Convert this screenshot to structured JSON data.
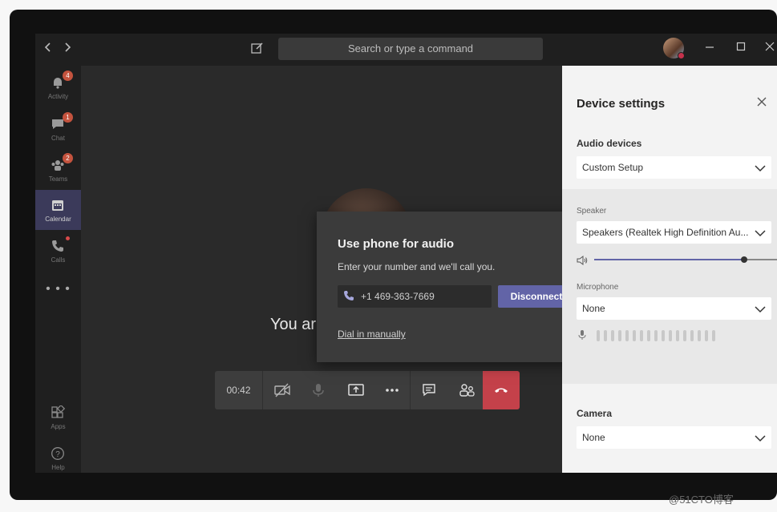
{
  "titlebar": {
    "back_icon": "chevron-left-icon",
    "forward_icon": "chevron-right-icon",
    "compose_icon": "compose-icon",
    "search_placeholder": "Search or type a command",
    "window_controls": [
      "minimize-icon",
      "maximize-icon",
      "close-icon"
    ]
  },
  "rail": {
    "items": [
      {
        "label": "Activity",
        "icon": "bell-icon",
        "badge": "4"
      },
      {
        "label": "Chat",
        "icon": "chat-icon",
        "badge": "1"
      },
      {
        "label": "Teams",
        "icon": "teams-icon",
        "badge": "2"
      },
      {
        "label": "Calendar",
        "icon": "calendar-icon",
        "badge": ""
      },
      {
        "label": "Calls",
        "icon": "phone-icon",
        "badge": ""
      }
    ],
    "more": "• • •",
    "bottom": [
      {
        "label": "Apps",
        "icon": "apps-icon"
      },
      {
        "label": "Help",
        "icon": "help-icon"
      }
    ]
  },
  "stage": {
    "you_text": "You ar"
  },
  "callbar": {
    "time": "00:42",
    "buttons": [
      "video-off-icon",
      "mic-icon",
      "share-screen-icon",
      "more-icon",
      "chat-icon",
      "participants-icon",
      "hang-up-icon"
    ]
  },
  "dialog": {
    "title": "Use phone for audio",
    "subtitle": "Enter your number and we'll call you.",
    "phone_value": "+1 469-363-7669",
    "button": "Disconnect",
    "link": "Dial in manually"
  },
  "panel": {
    "title": "Device settings",
    "audio_label": "Audio devices",
    "audio_value": "Custom Setup",
    "speaker_label": "Speaker",
    "speaker_value": "Speakers (Realtek High Definition Au...",
    "speaker_volume": 0.82,
    "microphone_label": "Microphone",
    "microphone_value": "None",
    "camera_label": "Camera",
    "camera_value": "None"
  },
  "colors": {
    "accent": "#6264a7",
    "hangup": "#c4414a",
    "badge": "#c4533e"
  },
  "watermark": "@51CTO博客"
}
